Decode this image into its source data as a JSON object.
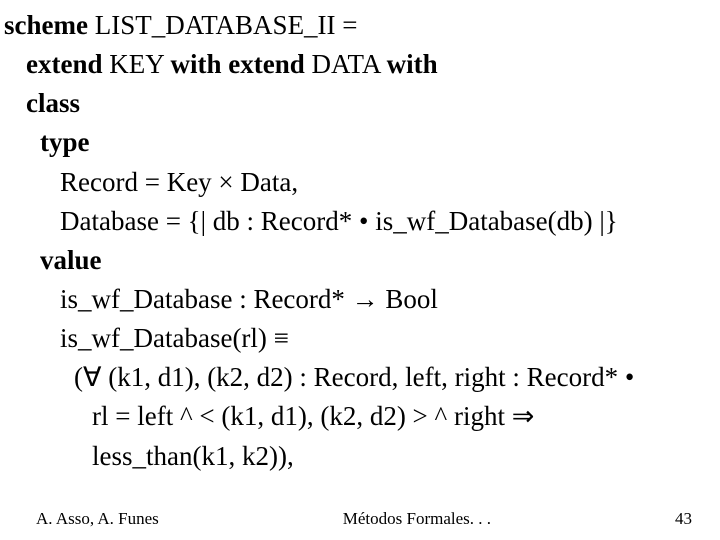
{
  "l1_kw": "scheme",
  "l1_rest": " LIST_DATABASE_II =",
  "l2_a": "extend",
  "l2_b": " KEY ",
  "l2_c": "with ",
  "l2_d": "extend",
  "l2_e": " DATA ",
  "l2_f": "with",
  "l3": "class",
  "l4": "type",
  "l5": "Record = Key × Data,",
  "l6": "Database = {| db : Record* • is_wf_Database(db) |}",
  "l7": "value",
  "l8": "is_wf_Database : Record* → Bool",
  "l9": "is_wf_Database(rl) ≡",
  "l10": "(∀ (k1, d1), (k2, d2) : Record, left, right : Record* •",
  "l11": "rl = left ^ < (k1, d1), (k2, d2) > ^ right ⇒",
  "l12": "less_than(k1, k2)),",
  "footer_left": "A. Asso, A. Funes",
  "footer_center": "Métodos Formales. . .",
  "footer_right": "43"
}
